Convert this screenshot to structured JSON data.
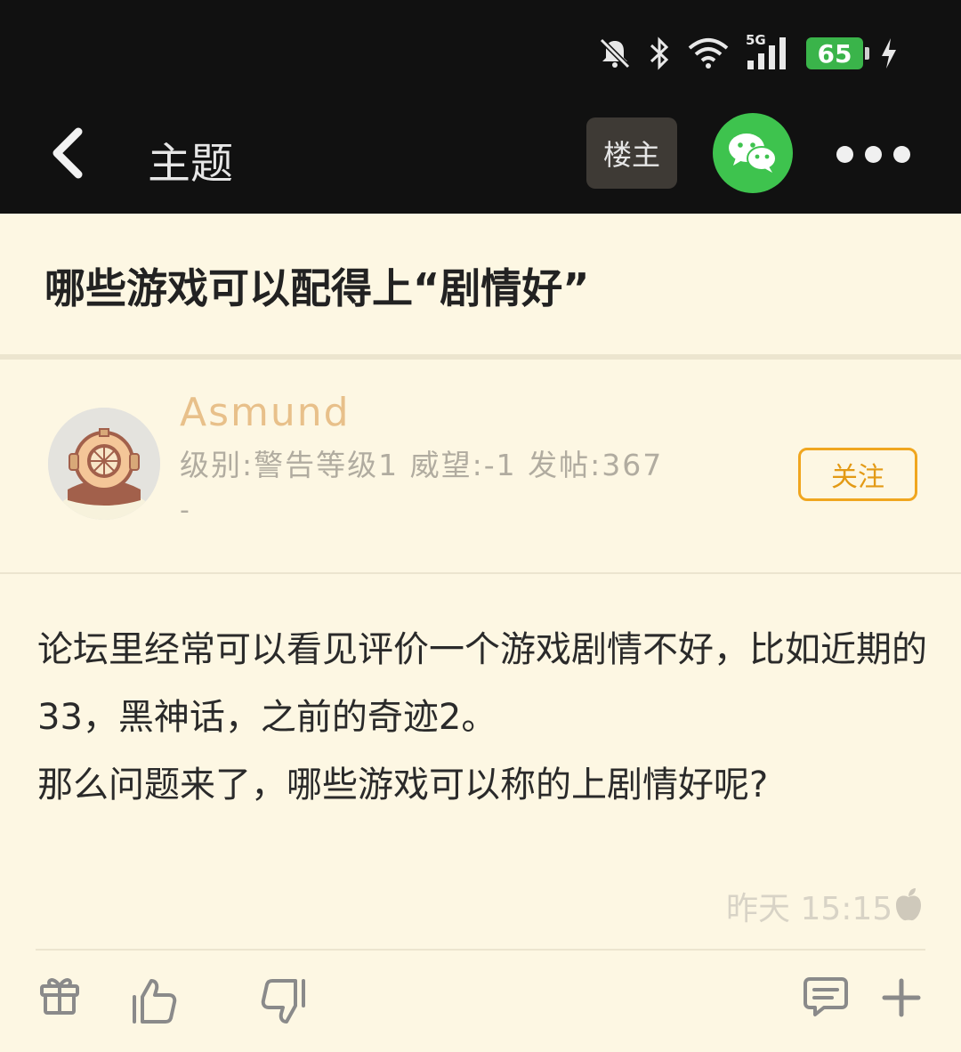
{
  "status_bar": {
    "time": "",
    "network": "5G",
    "battery": "65"
  },
  "header": {
    "back_icon": "chevron-left-icon",
    "title": "主题",
    "owner_label": "楼主",
    "share_icon": "wechat-icon",
    "more_icon": "more-dots-icon"
  },
  "thread": {
    "title": "哪些游戏可以配得上“剧情好”"
  },
  "author": {
    "name": "Asmund",
    "stats": "级别:警告等级1 威望:-1 发帖:367",
    "extra": "-",
    "follow_label": "关注",
    "avatar_icon": "diver-helmet-avatar"
  },
  "post": {
    "lines": [
      "论坛里经常可以看见评价一个游戏剧情不好，比如近期的33，黑神话，之前的奇迹2。",
      "那么问题来了，哪些游戏可以称的上剧情好呢?"
    ],
    "time": "昨天 15:15",
    "device_icon": "apple-icon"
  },
  "actions": [
    "gift-icon",
    "thumbs-up-icon",
    "thumbs-down-icon",
    "comment-icon",
    "plus-icon"
  ],
  "colors": {
    "background": "#fdf7e3",
    "header": "#111111",
    "accent": "#f0a61f",
    "username": "#e8c08a",
    "wechat": "#3ec34e"
  }
}
